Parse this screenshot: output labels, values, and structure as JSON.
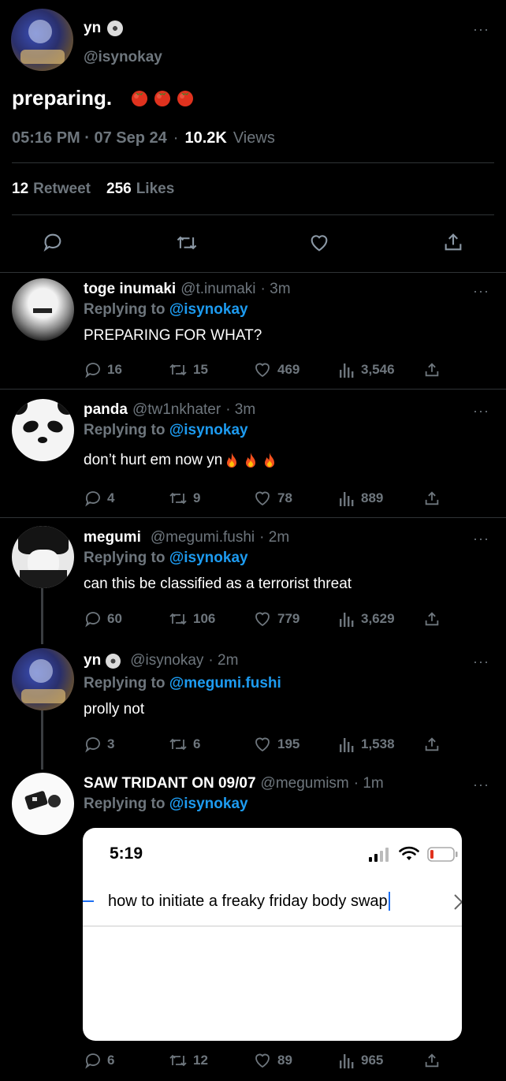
{
  "main_tweet": {
    "author_name": "yn",
    "author_handle": "@isynokay",
    "text": "preparing.",
    "time": "05:16 PM · 07 Sep 24",
    "views_count": "10.2K",
    "views_label": "Views",
    "retweet_count": "12",
    "retweet_label": "Retweet",
    "likes_count": "256",
    "likes_label": "Likes",
    "emoji": "tomato ×3"
  },
  "replies": [
    {
      "name": "toge inumaki",
      "handle": "@t.inumaki",
      "age": "· 3m",
      "replying_prefix": "Replying to",
      "replying_to": "@isynokay",
      "text": "PREPARING FOR WHAT?",
      "replies": "16",
      "retweets": "15",
      "likes": "469",
      "views": "3,546"
    },
    {
      "name": "panda",
      "handle": "@tw1nkhater",
      "age": "· 3m",
      "replying_prefix": "Replying to",
      "replying_to": "@isynokay",
      "text": "don’t hurt em now yn",
      "replies": "4",
      "retweets": "9",
      "likes": "78",
      "views": "889"
    },
    {
      "name": "megumi",
      "handle": "@megumi.fushi",
      "age": "· 2m",
      "replying_prefix": "Replying to",
      "replying_to": "@isynokay",
      "text": "can this be classified as a terrorist threat",
      "replies": "60",
      "retweets": "106",
      "likes": "779",
      "views": "3,629"
    },
    {
      "name": "yn",
      "handle": "@isynokay",
      "age": "· 2m",
      "replying_prefix": "Replying to",
      "replying_to": "@megumi.fushi",
      "text": "prolly not",
      "replies": "3",
      "retweets": "6",
      "likes": "195",
      "views": "1,538"
    },
    {
      "name": "SAW TRIDANT ON 09/07",
      "handle": "@megumism",
      "age": "· 1m",
      "replying_prefix": "Replying to",
      "replying_to": "@isynokay",
      "text": "",
      "replies": "6",
      "retweets": "12",
      "likes": "89",
      "views": "965"
    }
  ],
  "embedded_screenshot": {
    "clock": "5:19",
    "search_text": "how to initiate a freaky friday body swap"
  },
  "colors": {
    "background": "#000000",
    "link": "#1d9bf0",
    "muted": "#6e767d",
    "divider": "#2f3336"
  }
}
